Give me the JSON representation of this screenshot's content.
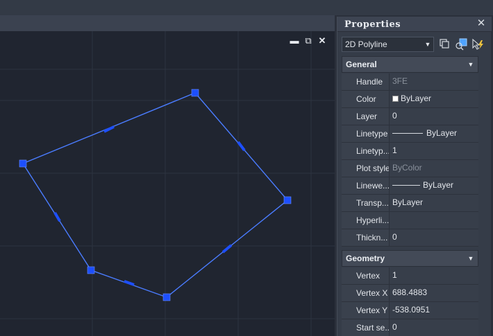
{
  "window_controls": {
    "minimize": "▬",
    "restore": "⧉",
    "close": "✕"
  },
  "properties_panel": {
    "title": "Properties",
    "close_icon": "✕",
    "object_type": "2D Polyline",
    "sections": {
      "general": {
        "label": "General",
        "rows": [
          {
            "label": "Handle",
            "value": "3FE",
            "dim": true
          },
          {
            "label": "Color",
            "value": "ByLayer",
            "swatch": "#ffffff"
          },
          {
            "label": "Layer",
            "value": "0"
          },
          {
            "label": "Linetype",
            "value": "ByLayer",
            "line_sample": true
          },
          {
            "label": "Linetyp...",
            "value": "1"
          },
          {
            "label": "Plot style",
            "value": "ByColor",
            "dim": true
          },
          {
            "label": "Linewe...",
            "value": "ByLayer",
            "line_sample": true
          },
          {
            "label": "Transp...",
            "value": "ByLayer"
          },
          {
            "label": "Hyperli...",
            "value": ""
          },
          {
            "label": "Thickn...",
            "value": "0"
          }
        ]
      },
      "geometry": {
        "label": "Geometry",
        "rows": [
          {
            "label": "Vertex",
            "value": "1"
          },
          {
            "label": "Vertex X",
            "value": "688.4883"
          },
          {
            "label": "Vertex Y",
            "value": "-538.0951"
          },
          {
            "label": "Start se...",
            "value": "0"
          }
        ]
      }
    }
  },
  "colors": {
    "viewport_bg": "#202530",
    "grid": "#2d3340",
    "polyline": "#4a7cff",
    "grip": "#1d4fff"
  }
}
